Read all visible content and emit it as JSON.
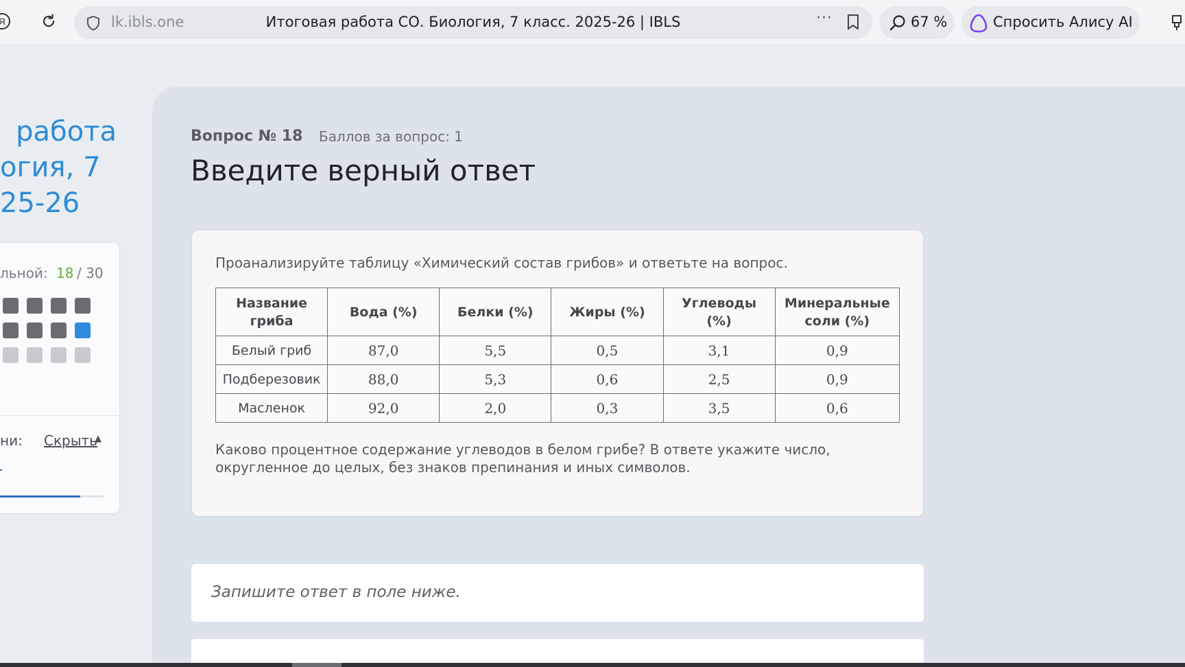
{
  "browser": {
    "domain": "lk.ibls.one",
    "tab_title": "Итоговая работа СО. Биология, 7 класс. 2025-26 | IBLS",
    "zoom": "67 %",
    "alice_label": "Спросить Алису AI"
  },
  "sidebar": {
    "title_line1": "работа",
    "title_line2": "огия, 7",
    "title_line3": "25-26",
    "progress_label": "льной:",
    "progress_current": "18",
    "progress_total": "/ 30",
    "time_label": "ни:",
    "hide_label": "Скрыть"
  },
  "question": {
    "number": "Вопрос № 18",
    "points": "Баллов за вопрос: 1",
    "heading": "Введите верный ответ",
    "intro": "Проанализируйте таблицу «Химический состав грибов» и ответьте на вопрос.",
    "text": "Каково процентное содержание углеводов в белом грибе? В ответе укажите число, округленное до целых, без знаков препинания и иных символов.",
    "table": {
      "headers": [
        "Название гриба",
        "Вода (%)",
        "Белки (%)",
        "Жиры (%)",
        "Углеводы (%)",
        "Минеральные соли (%)"
      ],
      "rows": [
        [
          "Белый гриб",
          "87,0",
          "5,5",
          "0,5",
          "3,1",
          "0,9"
        ],
        [
          "Подберезовик",
          "88,0",
          "5,3",
          "0,6",
          "2,5",
          "0,9"
        ],
        [
          "Масленок",
          "92,0",
          "2,0",
          "0,3",
          "3,5",
          "0,6"
        ]
      ]
    }
  },
  "answer": {
    "hint": "Запишите ответ в поле ниже."
  },
  "colors": {
    "accent": "#2e8cd6",
    "progress_current": "#5fae3b",
    "current_question": "#2d8be0"
  }
}
